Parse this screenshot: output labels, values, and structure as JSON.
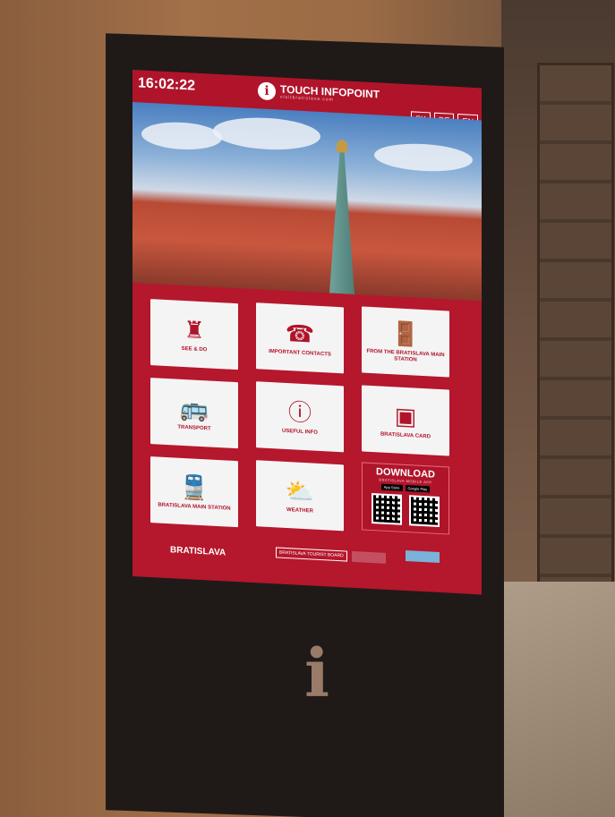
{
  "kiosk": {
    "clock": "16:02:22",
    "brand_title": "TOUCH INFOPOINT",
    "brand_url": "visitbratislava.com",
    "languages": [
      "SK",
      "DE",
      "EN"
    ],
    "tiles": [
      {
        "label": "SEE & DO",
        "icon": "castle-icon"
      },
      {
        "label": "IMPORTANT CONTACTS",
        "icon": "sos-phone-icon"
      },
      {
        "label": "FROM THE BRATISLAVA MAIN STATION",
        "icon": "exit-door-icon"
      },
      {
        "label": "TRANSPORT",
        "icon": "bus-stop-icon"
      },
      {
        "label": "USEFUL INFO",
        "icon": "info-icon"
      },
      {
        "label": "BRATISLAVA CARD",
        "icon": "card-icon"
      },
      {
        "label": "BRATISLAVA MAIN STATION",
        "icon": "train-icon"
      },
      {
        "label": "WEATHER",
        "icon": "weather-icon"
      }
    ],
    "download": {
      "title": "DOWNLOAD",
      "subtitle": "BRATISLAVA MOBILE APP",
      "stores": [
        "App Store",
        "Google Play"
      ]
    },
    "footer": {
      "logo": "BRATISLAVA",
      "tourist_board": "BRATISLAVA TOURIST BOARD"
    }
  }
}
